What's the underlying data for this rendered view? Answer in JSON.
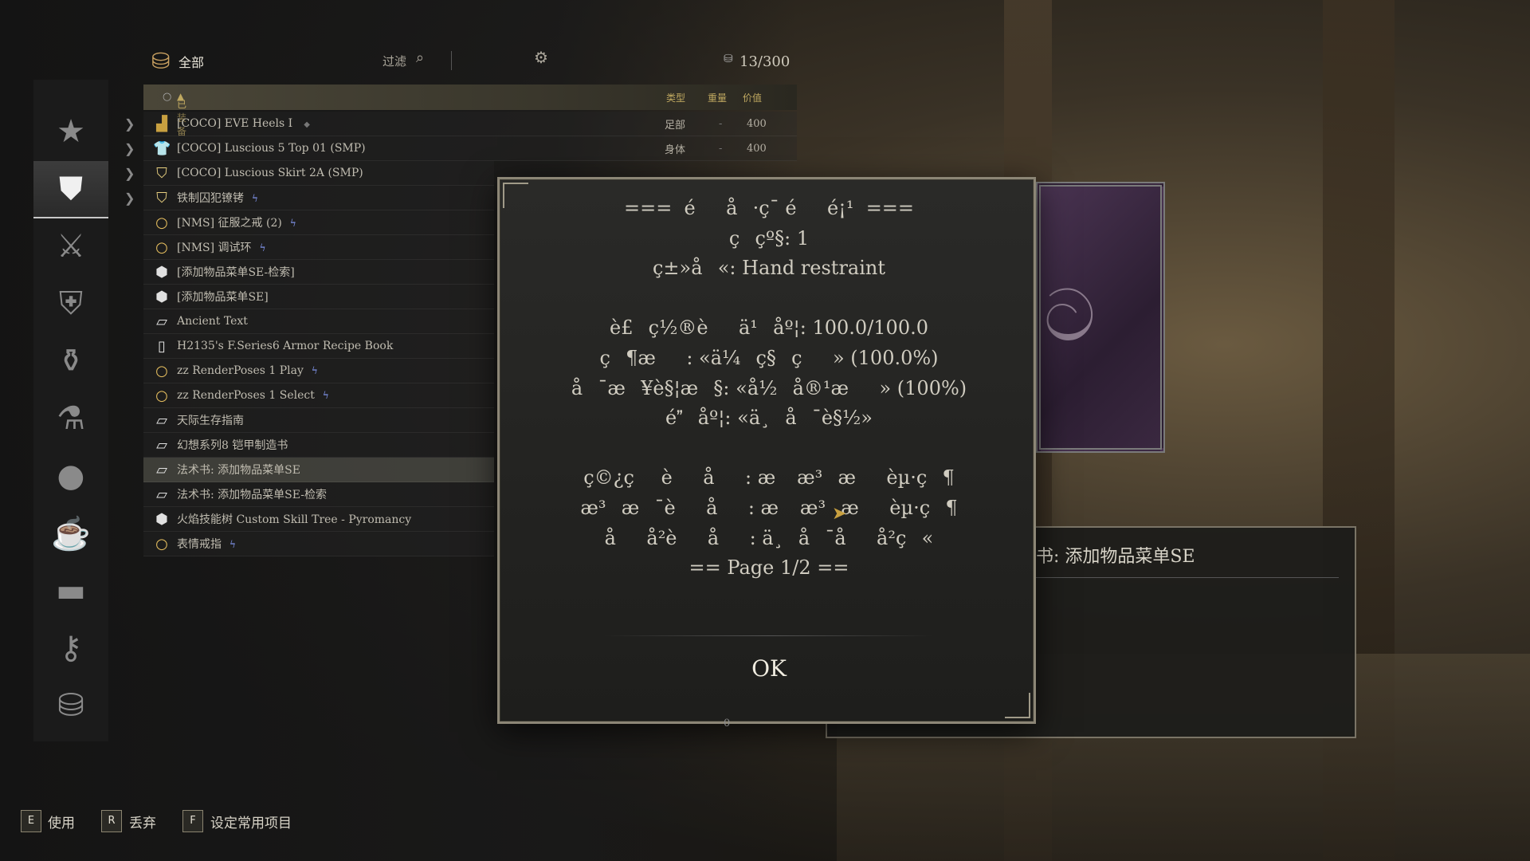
{
  "header": {
    "category_label": "全部",
    "filter_label": "过滤",
    "carry_weight": "13/300"
  },
  "columns": {
    "equipped": "已装备",
    "type": "类型",
    "weight": "重量",
    "value": "价值"
  },
  "categories": [
    {
      "name": "favorites",
      "icon": "★"
    },
    {
      "name": "apparel",
      "icon": "⛊"
    },
    {
      "name": "weapons",
      "icon": "⚔"
    },
    {
      "name": "armor",
      "icon": "⛨"
    },
    {
      "name": "potions",
      "icon": "⚱"
    },
    {
      "name": "scrolls",
      "icon": "⚗"
    },
    {
      "name": "food",
      "icon": "●"
    },
    {
      "name": "ingredients",
      "icon": "☕"
    },
    {
      "name": "books",
      "icon": "▬"
    },
    {
      "name": "keys",
      "icon": "⚷"
    },
    {
      "name": "misc",
      "icon": "⛁"
    }
  ],
  "items": [
    {
      "name": "[COCO] EVE Heels I",
      "suffix": "◆",
      "type": "足部",
      "weight": "-",
      "value": "400",
      "icon": "shoe-icon",
      "glyph": "▟",
      "color": "#c8a040",
      "expandable": true
    },
    {
      "name": "[COCO] Luscious 5 Top 01 (SMP)",
      "type": "身体",
      "weight": "-",
      "value": "400",
      "icon": "shirt-icon",
      "glyph": "👕",
      "color": "#e8d080",
      "expandable": true
    },
    {
      "name": "[COCO] Luscious Skirt 2A (SMP)",
      "icon": "shield-icon",
      "glyph": "⛉",
      "color": "#e8d080",
      "expandable": true
    },
    {
      "name": "铁制囚犯镣铐",
      "bolt": "ϟ",
      "icon": "shield-icon",
      "glyph": "⛉",
      "color": "#e8d080",
      "expandable": true
    },
    {
      "name": "[NMS] 征服之戒  (2)",
      "bolt": "ϟ",
      "icon": "ring-icon",
      "glyph": "○",
      "color": "#e8c060"
    },
    {
      "name": " [NMS] 调试环",
      "bolt": "ϟ",
      "icon": "ring-icon",
      "glyph": "○",
      "color": "#e8c060"
    },
    {
      "name": "[添加物品菜单SE-检索]",
      "icon": "box-icon",
      "glyph": "⬢",
      "color": "#e0e0e0"
    },
    {
      "name": "[添加物品菜单SE]",
      "icon": "box-icon",
      "glyph": "⬢",
      "color": "#e0e0e0"
    },
    {
      "name": "Ancient Text",
      "icon": "book-icon",
      "glyph": "▱",
      "color": "#e0e0e0"
    },
    {
      "name": "H2135's F.Series6 Armor Recipe Book",
      "icon": "note-icon",
      "glyph": "▯",
      "color": "#e0e0e0"
    },
    {
      "name": "zz RenderPoses 1 Play",
      "bolt": "ϟ",
      "icon": "ring-icon",
      "glyph": "○",
      "color": "#e8c060"
    },
    {
      "name": "zz RenderPoses 1 Select",
      "bolt": "ϟ",
      "icon": "ring-icon",
      "glyph": "○",
      "color": "#e8c060"
    },
    {
      "name": "天际生存指南",
      "icon": "book-icon",
      "glyph": "▱",
      "color": "#e0e0e0"
    },
    {
      "name": "幻想系列8 铠甲制造书",
      "icon": "book-icon",
      "glyph": "▱",
      "color": "#e0e0e0"
    },
    {
      "name": "法术书: 添加物品菜单SE",
      "icon": "book-icon",
      "glyph": "▱",
      "color": "#e0e0e0",
      "selected": true
    },
    {
      "name": "法术书: 添加物品菜单SE-检索",
      "icon": "book-icon",
      "glyph": "▱",
      "color": "#e0e0e0"
    },
    {
      "name": "火焰技能树 Custom Skill Tree - Pyromancy",
      "icon": "box-icon",
      "glyph": "⬢",
      "color": "#e0e0e0"
    },
    {
      "name": "表情戒指",
      "bolt": "ϟ",
      "icon": "ring-icon",
      "glyph": "○",
      "color": "#e8c060"
    }
  ],
  "item_card": {
    "title": "书: 添加物品菜单SE"
  },
  "modal": {
    "lines": [
      "===  éå·ç¯ éé¡¹  ===",
      "ç­çº§: 1",
      "ç±»å«: Hand restraint",
      "",
      "è£ç½®èä¹åº¦: 100.0/100.0",
      "ç¶æ: «ä¼ç§ç» (100.0%)",
      "å¯æ¥è§¦æ§: «å½å®¹æ» (100%)",
      "éåº¦: «ä¸å¯è§½»",
      "",
      "ç©¿çèå: æ æ³æèµ·ç¶",
      "æ³æ¯èå: æ æ³æèµ·ç¶",
      "åå²èå: ä¸å¯åå²ç«",
      "== Page 1/2 =="
    ],
    "ok_label": "OK",
    "pager": "0"
  },
  "footer": [
    {
      "key": "E",
      "label": "使用"
    },
    {
      "key": "R",
      "label": "丢弃"
    },
    {
      "key": "F",
      "label": "设定常用项目"
    }
  ],
  "colors": {
    "accent_gold": "#bfa860",
    "modal_border": "#8c8676",
    "enchant_blue": "#8aa0ff"
  }
}
